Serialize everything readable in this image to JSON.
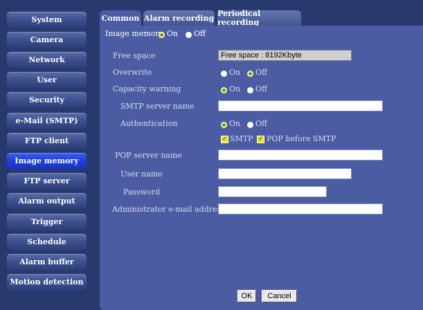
{
  "sidebar": {
    "items": [
      {
        "label": "System"
      },
      {
        "label": "Camera"
      },
      {
        "label": "Network"
      },
      {
        "label": "User"
      },
      {
        "label": "Security"
      },
      {
        "label": "e-Mail (SMTP)"
      },
      {
        "label": "FTP client"
      },
      {
        "label": "Image memory"
      },
      {
        "label": "FTP server"
      },
      {
        "label": "Alarm output"
      },
      {
        "label": "Trigger"
      },
      {
        "label": "Schedule"
      },
      {
        "label": "Alarm buffer"
      },
      {
        "label": "Motion detection"
      }
    ],
    "active": "Image memory"
  },
  "tabs": [
    {
      "label": "Common"
    },
    {
      "label": "Alarm recording"
    },
    {
      "label": "Periodical recording"
    }
  ],
  "form": {
    "image_memory": {
      "label": "Image memory",
      "on": "On",
      "off": "Off",
      "selected": "On"
    },
    "free_space": {
      "label": "Free space",
      "value": "Free space : 8192Kbyte"
    },
    "overwrite": {
      "label": "Overwrite",
      "on": "On",
      "off": "Off",
      "selected": "Off"
    },
    "capacity_warning": {
      "label": "Capacity warning",
      "on": "On",
      "off": "Off",
      "selected": "On"
    },
    "smtp_server_name": {
      "label": "SMTP server name",
      "value": ""
    },
    "authentication": {
      "label": "Authentication",
      "on": "On",
      "off": "Off",
      "selected": "On"
    },
    "auth_methods": {
      "smtp": "SMTP",
      "pop_before_smtp": "POP before SMTP",
      "smtp_checked": true,
      "pop_checked": true
    },
    "pop_server_name": {
      "label": "POP server name",
      "value": ""
    },
    "user_name": {
      "label": "User name",
      "value": ""
    },
    "password": {
      "label": "Password",
      "value": ""
    },
    "admin_email": {
      "label": "Administrator e-mail address",
      "value": ""
    }
  },
  "buttons": {
    "ok": "OK",
    "cancel": "Cancel"
  },
  "colors": {
    "background": "#27396d",
    "panel": "#4b5ca3",
    "active_nav": "#1f3fd9",
    "radio_selected": "#d8e000"
  }
}
